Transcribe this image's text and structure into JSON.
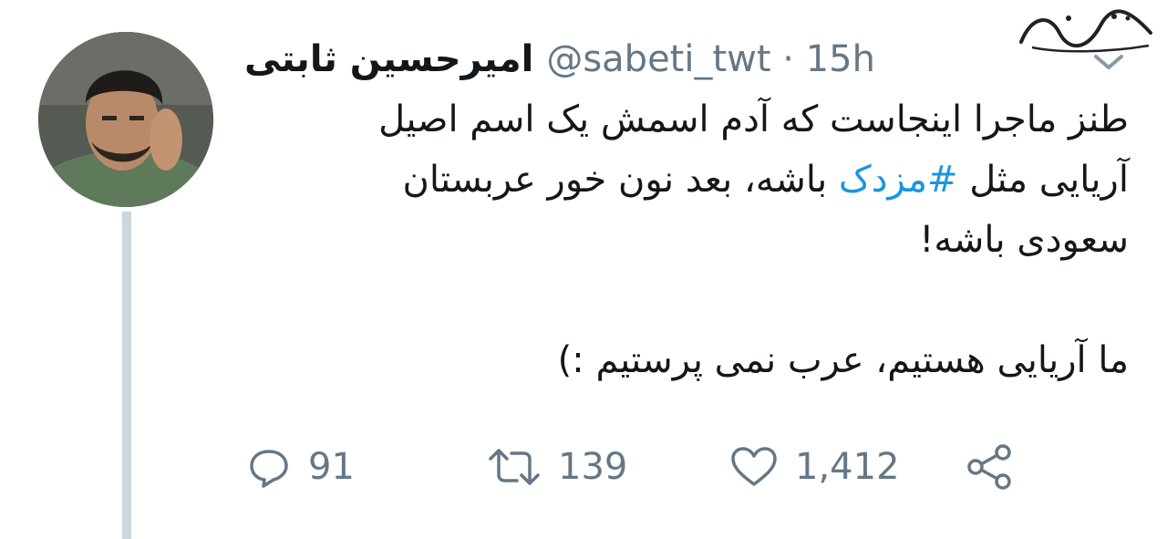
{
  "watermark": {
    "text": "شهدای ایران"
  },
  "tweet": {
    "display_name": "امیرحسین ثابتی",
    "handle": "@sabeti_twt",
    "separator": "·",
    "time": "15h",
    "body_lines": [
      [
        "طنز ماجرا اینجاست که آدم اسمش یک اسم اصیل"
      ],
      [
        "آریایی مثل ",
        "#مزدک",
        " باشه، بعد نون خور عربستان"
      ],
      [
        "سعودی باشه!"
      ],
      [],
      [
        "ما آریایی هستیم، عرب نمی پرستیم :)"
      ]
    ],
    "hashtag": "#مزدک",
    "line1": "طنز ماجرا اینجاست که آدم اسمش یک اسم اصیل",
    "line2_before": "آریایی مثل ",
    "line2_after": " باشه، بعد نون خور عربستان",
    "line3": "سعودی باشه!",
    "line5": "ما آریایی هستیم، عرب نمی پرستیم :)"
  },
  "actions": {
    "reply_count": "91",
    "retweet_count": "139",
    "like_count": "1,412"
  },
  "colors": {
    "text": "#14171a",
    "secondary": "#657786",
    "link": "#1b95e0",
    "thread_line": "#cdd6de"
  },
  "icons": {
    "reply": "reply-icon",
    "retweet": "retweet-icon",
    "like": "heart-icon",
    "share": "share-icon",
    "menu": "chevron-down-icon"
  }
}
